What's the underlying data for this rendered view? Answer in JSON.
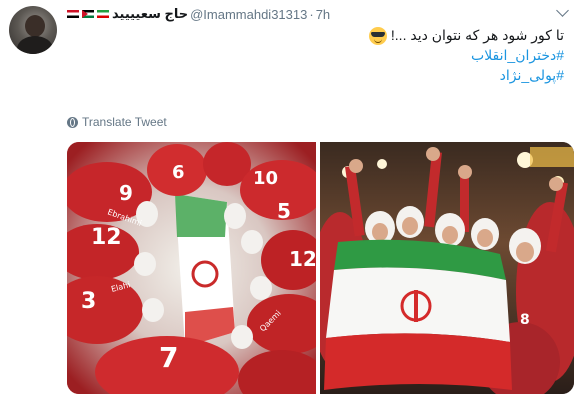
{
  "user": {
    "display_name": "حاج سعیییید",
    "handle": "@Imammahdi31313",
    "separator": "·",
    "time": "7h"
  },
  "tweet": {
    "text_line1": "تا کور شود هر که نتوان دید ...!",
    "hashtag1": "#دختران_انقلاب",
    "hashtag2": "#پولی_نژاد"
  },
  "translate_label": "Translate Tweet",
  "icons": [
    "avatar",
    "egypt-flag-icon",
    "palestine-flag-icon",
    "iran-flag-icon",
    "chevron-down-icon",
    "sunglasses-emoji-icon",
    "globe-icon"
  ],
  "colors": {
    "link": "#1b95e0",
    "meta": "#657786",
    "text": "#14171a"
  },
  "jersey_numbers_left": [
    "9",
    "6",
    "10",
    "5",
    "12",
    "12",
    "3",
    "7"
  ],
  "jersey_numbers_right": [
    "8"
  ],
  "photo_left_labels": [
    "Ebrahimi",
    "Ebrahimi",
    "Elahi",
    "Elahi",
    "Qaemi",
    "Qaemi"
  ]
}
